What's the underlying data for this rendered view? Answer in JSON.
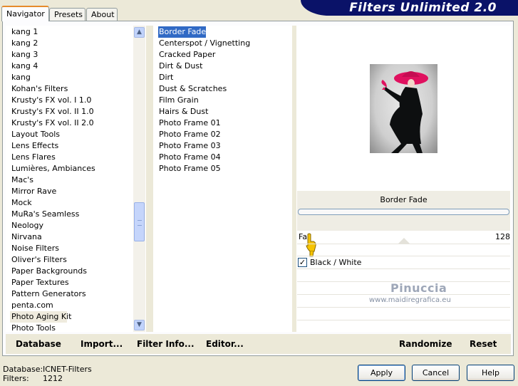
{
  "tabs": [
    "Navigator",
    "Presets",
    "About"
  ],
  "banner_title": "Filters Unlimited 2.0",
  "categories": [
    "kang 1",
    "kang 2",
    "kang 3",
    "kang 4",
    "kang",
    "Kohan's Filters",
    "Krusty's FX vol. I 1.0",
    "Krusty's FX vol. II 1.0",
    "Krusty's FX vol. II 2.0",
    "Layout Tools",
    "Lens Effects",
    "Lens Flares",
    "Lumières, Ambiances",
    "Mac's",
    "Mirror Rave",
    "Mock",
    "MuRa's Seamless",
    "Neology",
    "Nirvana",
    "Noise Filters",
    "Oliver's Filters",
    "Paper Backgrounds",
    "Paper Textures",
    "Pattern Generators",
    "penta.com",
    "Photo Aging Kit",
    "Photo Tools"
  ],
  "selected_category": "Photo Aging Kit",
  "filters": [
    "Border Fade",
    "Centerspot / Vignetting",
    "Cracked Paper",
    "Dirt & Dust",
    "Dirt",
    "Dust & Scratches",
    "Film Grain",
    "Hairs & Dust",
    "Photo Frame 01",
    "Photo Frame 02",
    "Photo Frame 03",
    "Photo Frame 04",
    "Photo Frame 05"
  ],
  "selected_filter": "Border Fade",
  "filter_name_display": "Border Fade",
  "param": {
    "label": "Fa",
    "value": "128"
  },
  "checkbox": {
    "label": "Black / White",
    "checked": true
  },
  "watermark": {
    "name": "Pinuccia",
    "url": "www.maidiregrafica.eu"
  },
  "bottom_buttons": [
    "Database",
    "Import...",
    "Filter Info...",
    "Editor..."
  ],
  "right_buttons": [
    "Randomize",
    "Reset"
  ],
  "status": {
    "database_label": "Database:",
    "database_value": "ICNET-Filters",
    "filters_label": "Filters:",
    "filters_value": "1212"
  },
  "dialog_buttons": [
    "Apply",
    "Cancel",
    "Help"
  ],
  "colors": {
    "banner": "#0a1268",
    "selection": "#316ac5",
    "hat": "#e0115f"
  }
}
